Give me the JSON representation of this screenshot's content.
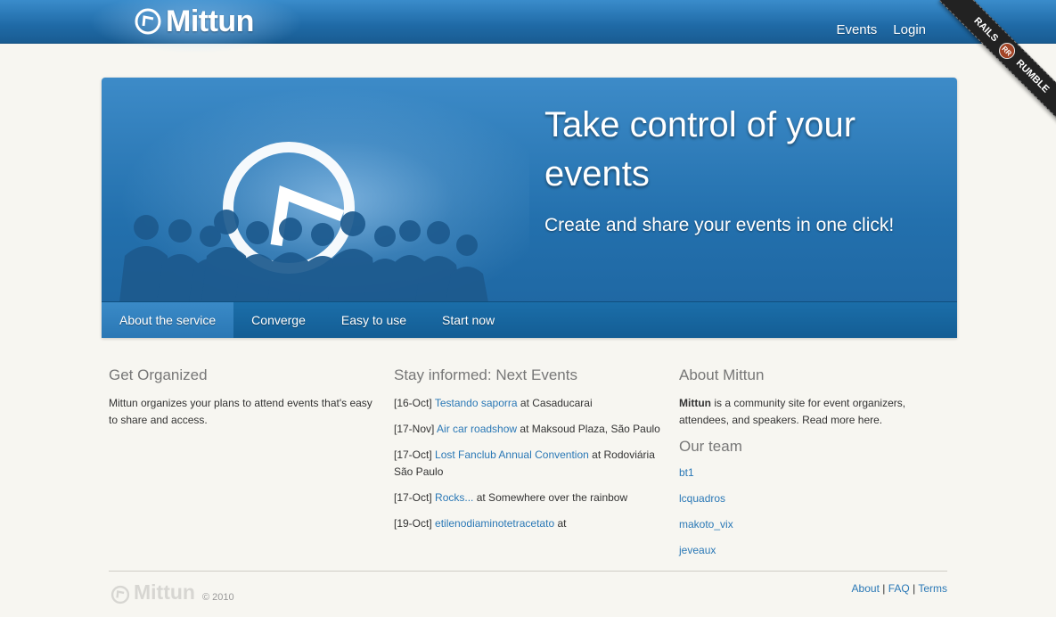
{
  "brand": {
    "name": "Mittun",
    "logo_icon": "clock-logo-icon"
  },
  "topnav": {
    "events": "Events",
    "login": "Login"
  },
  "ribbon": {
    "left": "RAILS",
    "badge": "RR",
    "right": "RUMBLE"
  },
  "hero": {
    "title": "Take control of your events",
    "subtitle": "Create and share your events in one click!",
    "tabs": [
      {
        "label": "About the service",
        "active": true
      },
      {
        "label": "Converge",
        "active": false
      },
      {
        "label": "Easy to use",
        "active": false
      },
      {
        "label": "Start now",
        "active": false
      }
    ]
  },
  "organized": {
    "heading": "Get Organized",
    "text": "Mittun organizes your plans to attend events that's easy to share and access."
  },
  "events": {
    "heading": "Stay informed: Next Events",
    "items": [
      {
        "date": "[16-Oct]",
        "name": "Testando saporra",
        "at": "at Casaducarai"
      },
      {
        "date": "[17-Nov]",
        "name": "Air car roadshow",
        "at": "at Maksoud Plaza, São Paulo"
      },
      {
        "date": "[17-Oct]",
        "name": "Lost Fanclub Annual Convention",
        "at": "at Rodoviária São Paulo"
      },
      {
        "date": "[17-Oct]",
        "name": "Rocks...",
        "at": "at Somewhere over the rainbow"
      },
      {
        "date": "[19-Oct]",
        "name": "etilenodiaminotetracetato",
        "at": "at"
      }
    ]
  },
  "about": {
    "heading": "About Mittun",
    "strong": "Mittun",
    "text": " is a community site for event organizers, attendees, and speakers. Read more here."
  },
  "team": {
    "heading": "Our team",
    "members": [
      "bt1",
      "lcquadros",
      "makoto_vix",
      "jeveaux"
    ]
  },
  "footer": {
    "brand": "Mittun",
    "copyright": "© 2010",
    "links": [
      "About",
      "FAQ",
      "Terms"
    ],
    "separator": "|"
  },
  "colors": {
    "primary": "#2370ad",
    "link": "#2a78b6",
    "background": "#f7f6f1"
  }
}
